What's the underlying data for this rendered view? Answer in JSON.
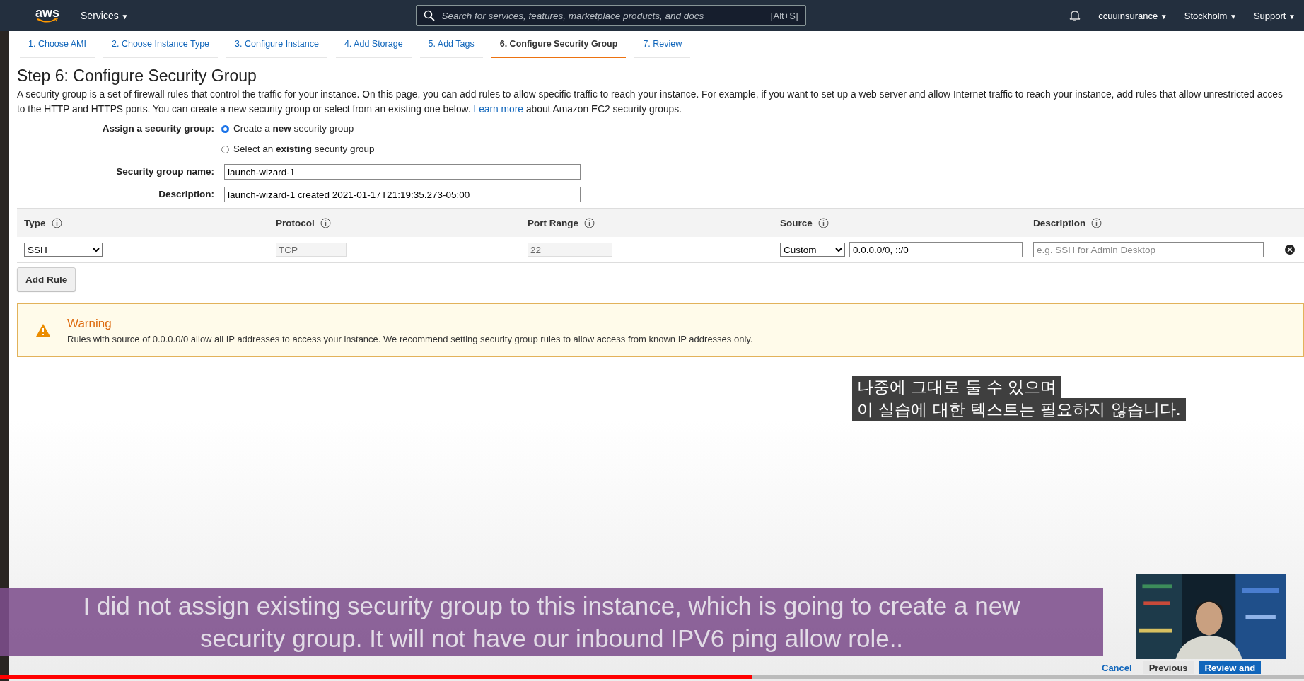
{
  "top_nav": {
    "logo": "aws",
    "services": "Services",
    "caret": "▼",
    "search": {
      "placeholder": "Search for services, features, marketplace products, and docs",
      "shortcut": "[Alt+S]"
    },
    "account": "ccuuinsurance",
    "region": "Stockholm",
    "support": "Support"
  },
  "steps": [
    {
      "label": "1. Choose AMI",
      "selected": false
    },
    {
      "label": "2. Choose Instance Type",
      "selected": false
    },
    {
      "label": "3. Configure Instance",
      "selected": false
    },
    {
      "label": "4. Add Storage",
      "selected": false
    },
    {
      "label": "5. Add Tags",
      "selected": false
    },
    {
      "label": "6. Configure Security Group",
      "selected": true
    },
    {
      "label": "7. Review",
      "selected": false
    }
  ],
  "heading": "Step 6: Configure Security Group",
  "intro": {
    "text": "A security group is a set of firewall rules that control the traffic for your instance. On this page, you can add rules to allow specific traffic to reach your instance. For example, if you want to set up a web server and allow Internet traffic to reach your instance, add rules that allow unrestricted acces\nto the HTTP and HTTPS ports. You can create a new security group or select from an existing one below.",
    "link": "Learn more",
    "after": "about Amazon EC2 security groups."
  },
  "assign": {
    "label": "Assign a security group:",
    "options": [
      {
        "text": "Create a **new** security group",
        "selected": true
      },
      {
        "text": "Select an **existing** security group",
        "selected": false
      }
    ]
  },
  "fields": [
    {
      "label": "Security group name:",
      "value": "launch-wizard-1"
    },
    {
      "label": "Description:",
      "value": "launch-wizard-1 created 2021-01-17T21:19:35.273-05:00"
    }
  ],
  "rules_table": {
    "columns": [
      "Type",
      "Protocol",
      "Port Range",
      "Source",
      "Description"
    ],
    "rows": [
      {
        "type": "SSH",
        "protocol": "TCP",
        "port_range": "22",
        "source": "Custom",
        "source_cidr": "0.0.0.0/0, ::/0",
        "description_placeholder": "e.g. SSH for Admin Desktop"
      }
    ]
  },
  "add_rule": "Add Rule",
  "warning": {
    "title": "Warning",
    "message": "Rules with source of 0.0.0.0/0 allow all IP addresses to access your instance. We recommend setting security group rules to allow access from known IP addresses only."
  },
  "footer_buttons": [
    "Cancel",
    "Previous",
    "Review and"
  ],
  "video_overlay": {
    "subtitle_lines": [
      "나중에 그대로 둘 수 있으며",
      "이 실습에 대한 텍스트는 필요하지 않습니다."
    ],
    "caption": "I did not assign existing security group to this instance, which is going to create a new\nsecurity group. It will not have our inbound IPV6 ping allow role..",
    "webcam": {
      "kind": "picture"
    },
    "progress": {
      "level": 0.577
    }
  }
}
